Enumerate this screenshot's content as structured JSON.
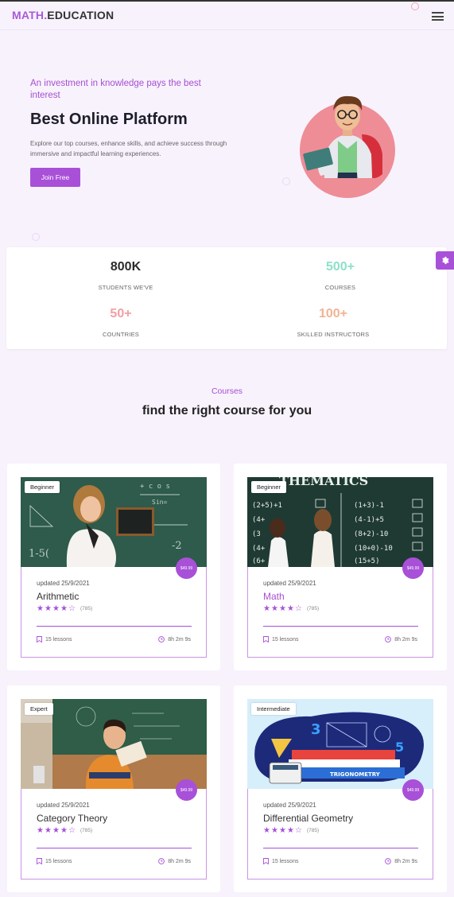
{
  "nav": {
    "logo_part1": "MATH.",
    "logo_part2": "EDUCATION",
    "menu_icon": "hamburger-icon"
  },
  "hero": {
    "tagline": "An investment in knowledge pays the best interest",
    "title": "Best Online Platform",
    "description": "Explore our top courses, enhance skills, and achieve success through immersive and impactful learning experiences.",
    "cta_label": "Join Free"
  },
  "stats": [
    {
      "value": "800K",
      "label": "STUDENTS WE'VE",
      "color": "#2b2b2b"
    },
    {
      "value": "500+",
      "label": "COURSES",
      "color": "#8ee0c9"
    },
    {
      "value": "50+",
      "label": "COUNTRIES",
      "color": "#f0a0a3"
    },
    {
      "value": "100+",
      "label": "SKILLED INSTRUCTORS",
      "color": "#f0b494"
    }
  ],
  "courses_section": {
    "tag": "Courses",
    "title": "find the right course for you"
  },
  "courses": [
    {
      "level": "Beginner",
      "price": "$49.99",
      "updated": "updated 25/9/2021",
      "title": "Arithmetic",
      "rating": 4.5,
      "reviews": "(785)",
      "lessons": "15 lessons",
      "duration": "8h 2m 9s",
      "highlighted": false
    },
    {
      "level": "Beginner",
      "price": "$49.99",
      "updated": "updated 25/9/2021",
      "title": "Math",
      "rating": 4.5,
      "reviews": "(785)",
      "lessons": "15 lessons",
      "duration": "8h 2m 9s",
      "highlighted": true
    },
    {
      "level": "Expert",
      "price": "$49.99",
      "updated": "updated 25/9/2021",
      "title": "Category Theory",
      "rating": 4.5,
      "reviews": "(785)",
      "lessons": "15 lessons",
      "duration": "8h 2m 9s",
      "highlighted": false
    },
    {
      "level": "Intermediate",
      "price": "$49.99",
      "updated": "updated 25/9/2021",
      "title": "Differential Geometry",
      "rating": 4.5,
      "reviews": "(785)",
      "lessons": "15 lessons",
      "duration": "8h 2m 9s",
      "highlighted": false
    }
  ],
  "colors": {
    "accent": "#a850d8",
    "background": "#f8f2fd"
  }
}
